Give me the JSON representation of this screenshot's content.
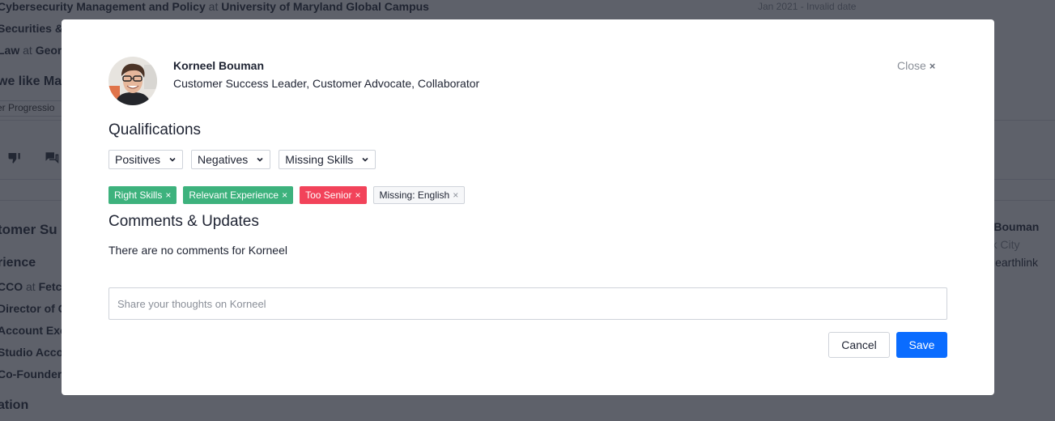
{
  "background": {
    "education_lines": [
      {
        "field": "Cybersecurity Management and Policy",
        "at": "at",
        "school": "University of Maryland Global Campus"
      },
      {
        "field": "Securities &",
        "at": "",
        "school": ""
      },
      {
        "field": "Law",
        "at": "at",
        "school": "Georg"
      }
    ],
    "date_range": "Jan 2021 - Invalid date",
    "why_heading": "we like Ma",
    "tab_label": "er Progressio",
    "candidate_heading": "tomer Su",
    "experience_heading": "rience",
    "experience_items": [
      {
        "role": "CCO",
        "at": "at",
        "company": "Fetch"
      },
      {
        "role": "Director of C",
        "at": "",
        "company": ""
      },
      {
        "role": "Account Exe",
        "at": "",
        "company": ""
      },
      {
        "role": "Studio Acco",
        "at": "",
        "company": ""
      },
      {
        "role": "Co-Founder,",
        "at": "",
        "company": ""
      }
    ],
    "education_heading": "ation",
    "side_name": "eel Bouman",
    "side_location": "York City",
    "side_email": "el@earthlink",
    "icons": [
      "thumbs-down-icon",
      "comments-icon"
    ]
  },
  "modal": {
    "candidate": {
      "name": "Korneel Bouman",
      "headline": "Customer Success Leader, Customer Advocate, Collaborator"
    },
    "close_label": "Close",
    "close_glyph": "×",
    "qualifications_title": "Qualifications",
    "dropdowns": [
      {
        "label": "Positives"
      },
      {
        "label": "Negatives"
      },
      {
        "label": "Missing Skills"
      }
    ],
    "tags": [
      {
        "label": "Right Skills",
        "type": "positive",
        "color": "#3db27d"
      },
      {
        "label": "Relevant Experience",
        "type": "positive",
        "color": "#3db27d"
      },
      {
        "label": "Too Senior",
        "type": "negative",
        "color": "#f2435a"
      },
      {
        "label": "Missing: English",
        "type": "missing",
        "color": "#f6f7f9"
      }
    ],
    "tag_remove_glyph": "×",
    "comments_title": "Comments & Updates",
    "no_comments_text": "There are no comments for Korneel",
    "comment_placeholder": "Share your thoughts on Korneel",
    "comment_value": "",
    "cancel_label": "Cancel",
    "save_label": "Save",
    "accent_color": "#0a6cff"
  }
}
